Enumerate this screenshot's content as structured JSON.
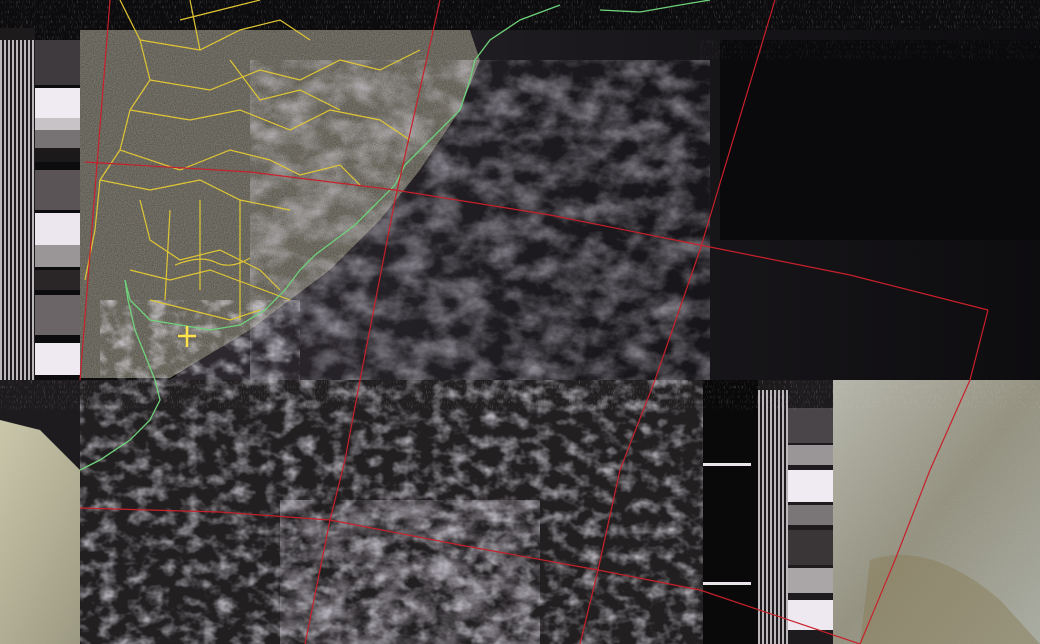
{
  "image": {
    "kind": "weather-satellite-apt-decode",
    "overlays": [
      "country-borders",
      "coastline",
      "lat-lon-grid",
      "city-marker"
    ]
  },
  "colors": {
    "background": "#0b0b0c",
    "land_dark": "#3a3a30",
    "land_mid": "#555246",
    "ocean": "#141418",
    "cloud": "#b9b1c4",
    "cloud_bright": "#e6e0ec",
    "border_lines": "#e0c634",
    "coastline": "#6fd27a",
    "graticule": "#c8202a",
    "marker": "#ffe24a",
    "sync_bar_light": "#f1ecf2",
    "sync_bar_dark": "#1a1718"
  },
  "panels": {
    "upper": {
      "label": ""
    },
    "lower": {
      "label": ""
    }
  },
  "marker": {
    "label": ""
  }
}
